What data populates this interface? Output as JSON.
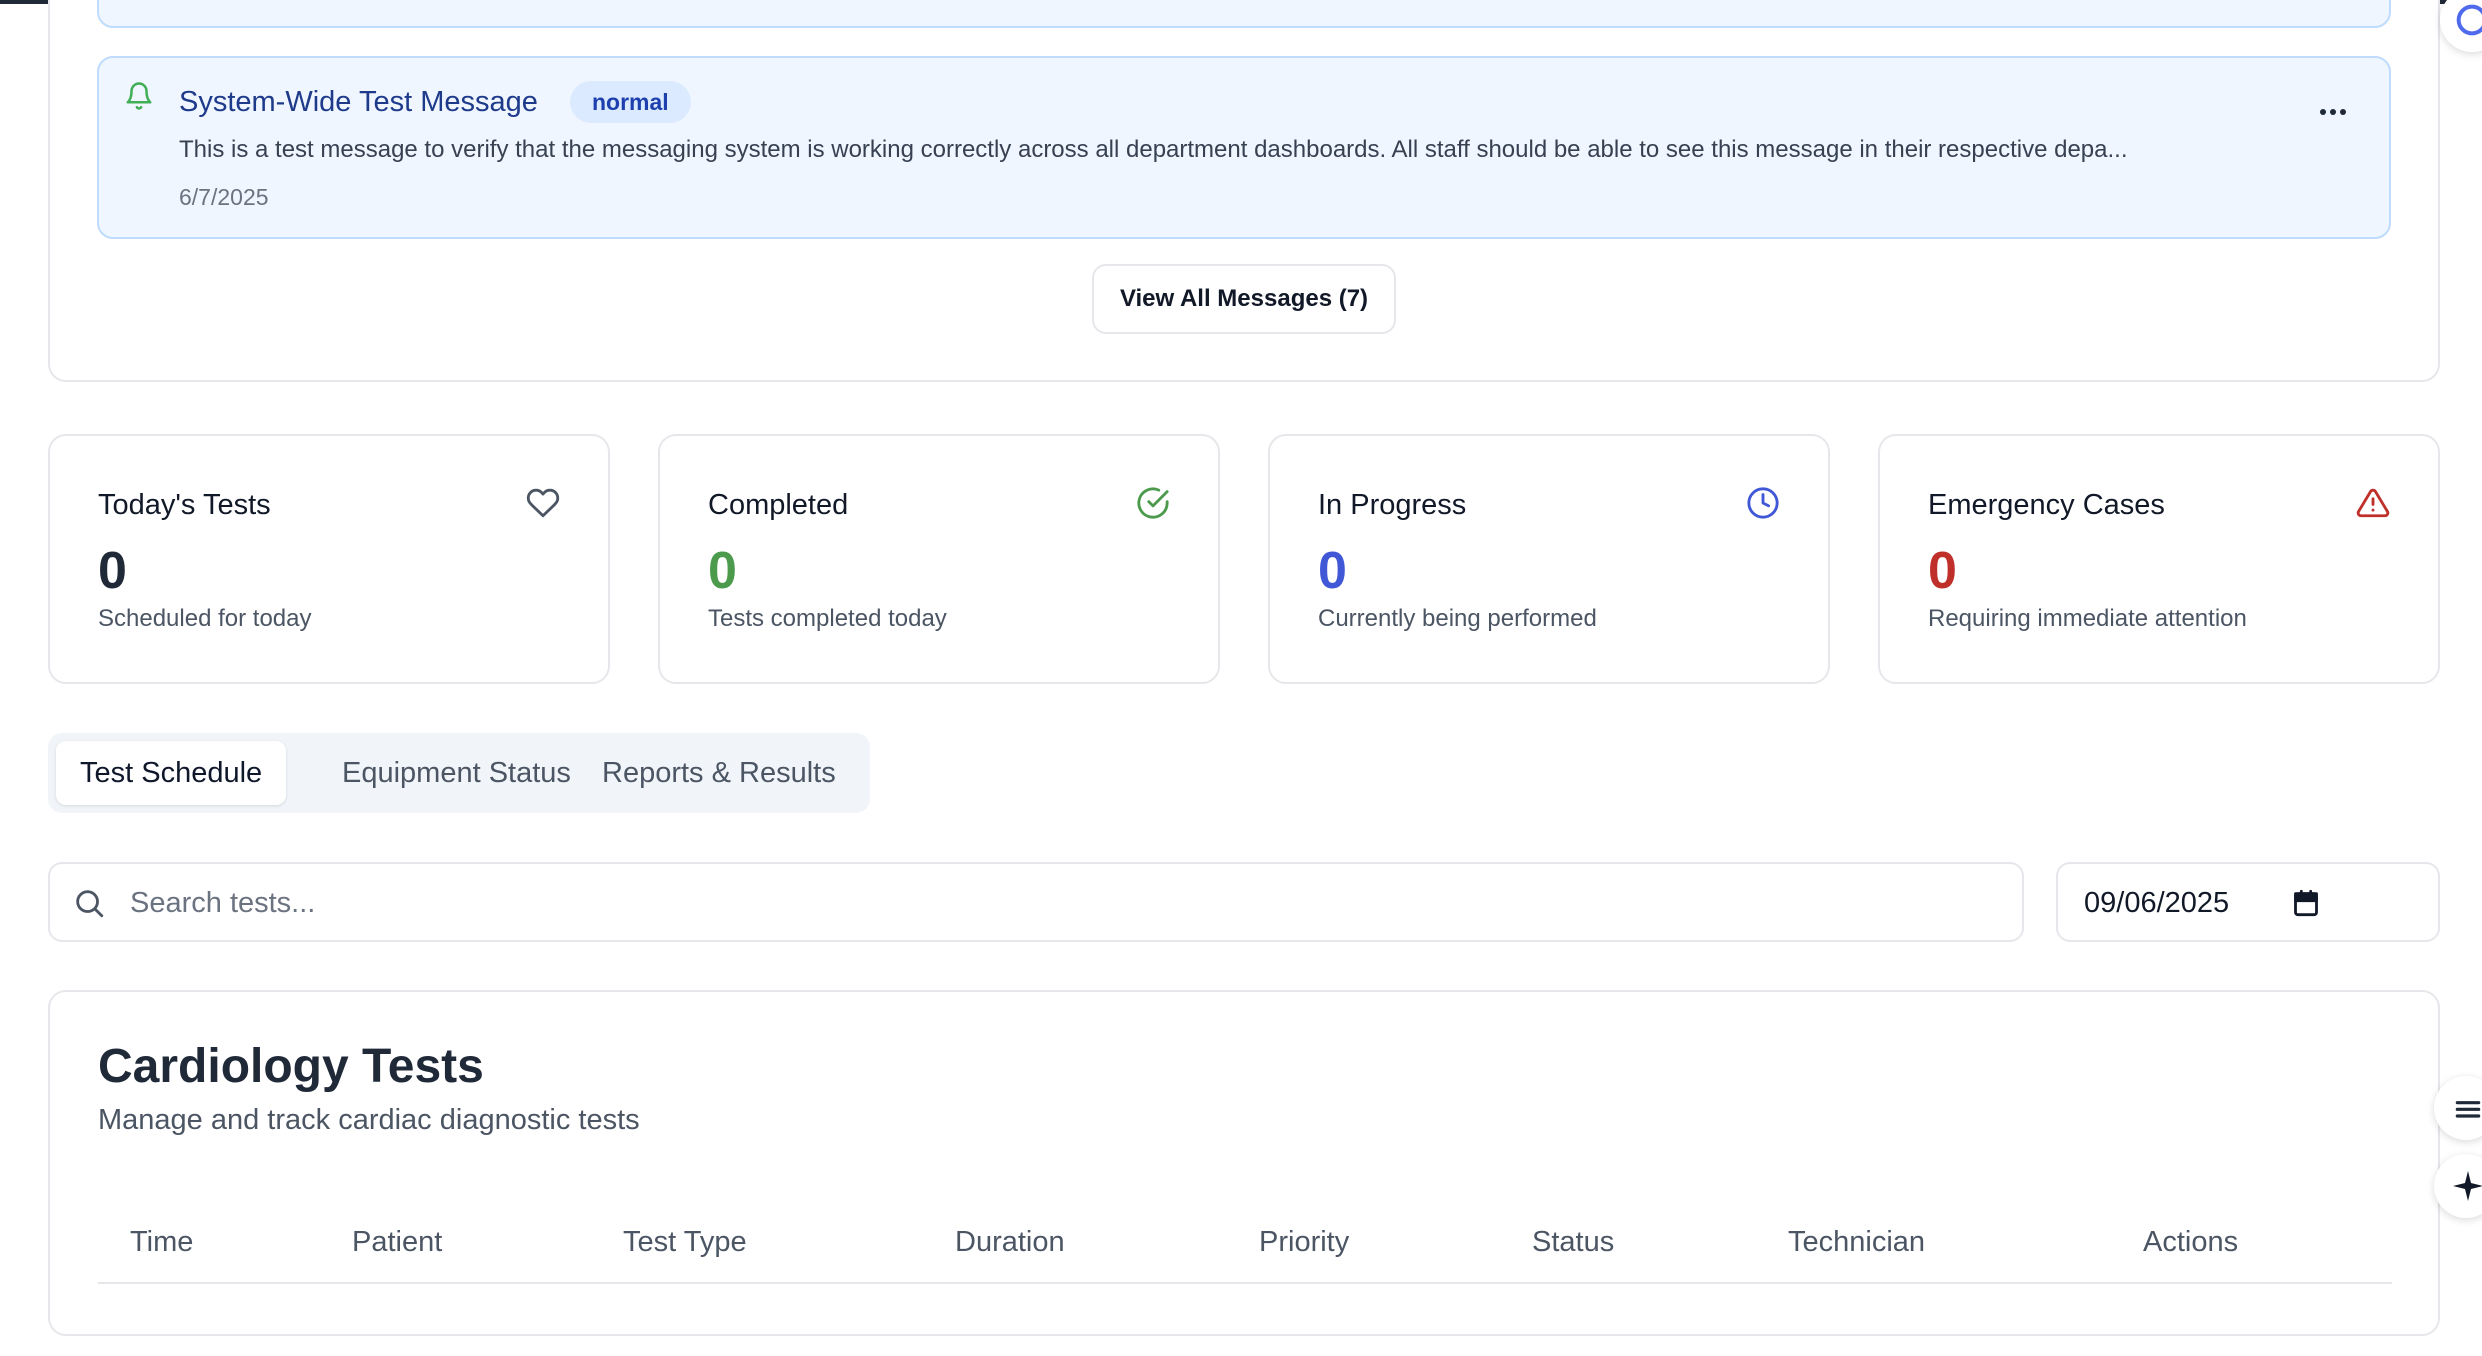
{
  "messages": {
    "item": {
      "title": "System-Wide Test Message",
      "priority": "normal",
      "body": "This is a test message to verify that the messaging system is working correctly across all department dashboards. All staff should be able to see this message in their respective depa...",
      "date": "6/7/2025"
    },
    "view_all_label": "View All Messages (7)"
  },
  "stats": [
    {
      "title": "Today's Tests",
      "value": "0",
      "subtitle": "Scheduled for today",
      "icon": "heart-icon",
      "color": "#1f2937"
    },
    {
      "title": "Completed",
      "value": "0",
      "subtitle": "Tests completed today",
      "icon": "check-circle-icon",
      "color": "#4c9a4c"
    },
    {
      "title": "In Progress",
      "value": "0",
      "subtitle": "Currently being performed",
      "icon": "clock-icon",
      "color": "#4057d6"
    },
    {
      "title": "Emergency Cases",
      "value": "0",
      "subtitle": "Requiring immediate attention",
      "icon": "alert-triangle-icon",
      "color": "#c0302b"
    }
  ],
  "tabs": [
    {
      "label": "Test Schedule",
      "active": true
    },
    {
      "label": "Equipment Status",
      "active": false
    },
    {
      "label": "Reports & Results",
      "active": false
    }
  ],
  "search": {
    "placeholder": "Search tests...",
    "value": ""
  },
  "date_filter": {
    "value": "09/06/2025"
  },
  "table": {
    "title": "Cardiology Tests",
    "subtitle": "Manage and track cardiac diagnostic tests",
    "columns": [
      "Time",
      "Patient",
      "Test Type",
      "Duration",
      "Priority",
      "Status",
      "Technician",
      "Actions"
    ]
  },
  "colors": {
    "accent_blue": "#1e40af",
    "success_green": "#4c9a4c",
    "progress_blue": "#4057d6",
    "danger_red": "#c0302b"
  }
}
